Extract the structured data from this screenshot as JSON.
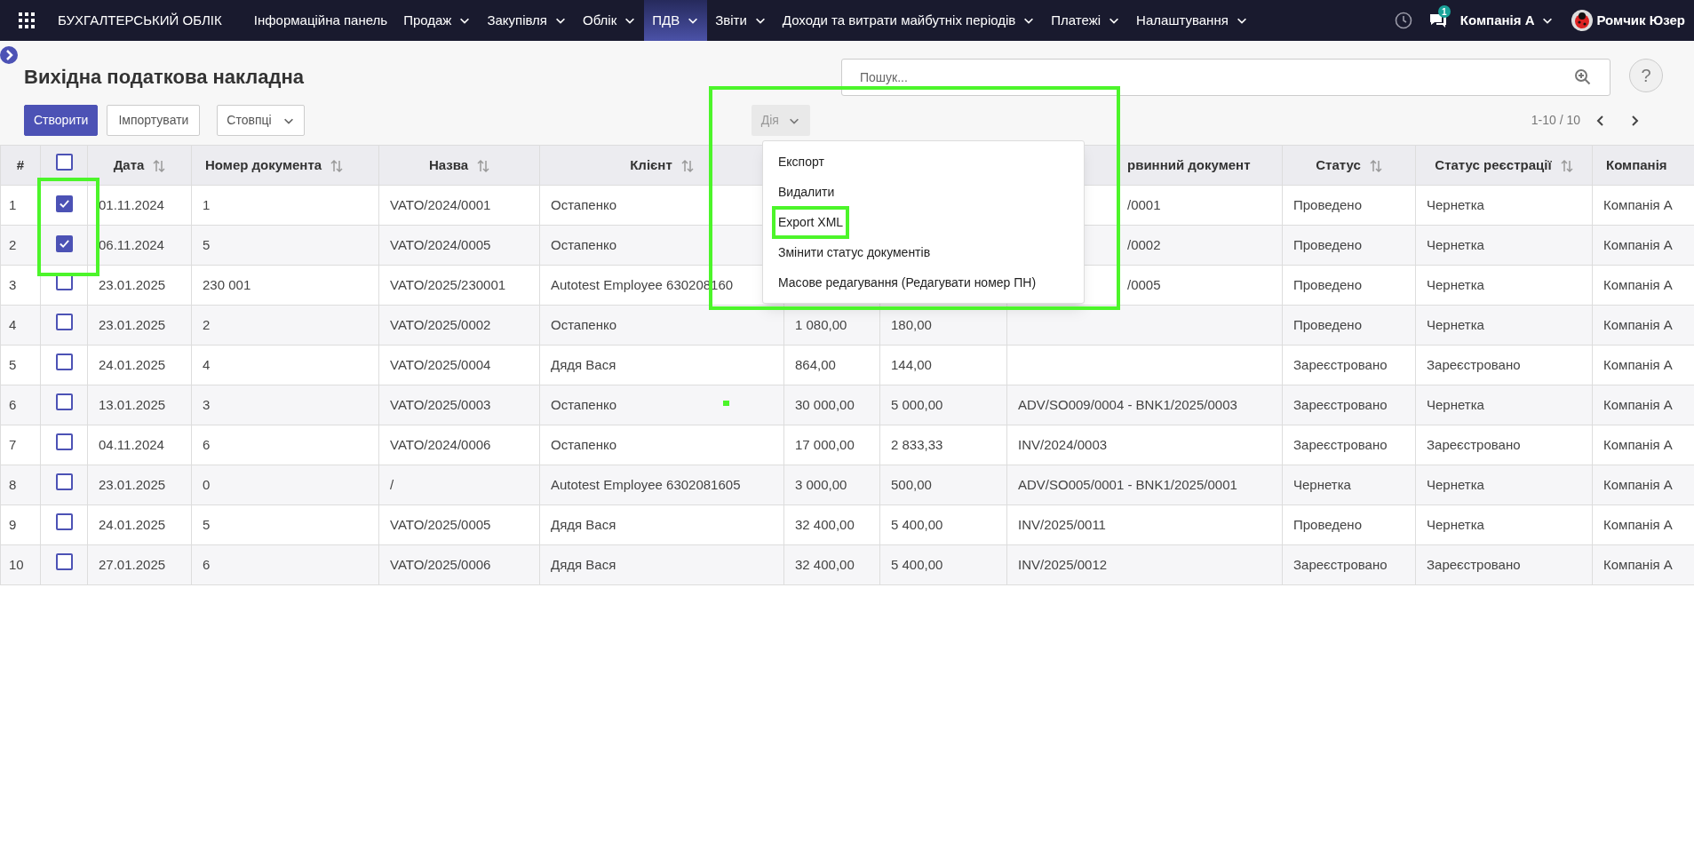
{
  "navbar": {
    "app_title": "БУХГАЛТЕРСЬКИЙ ОБЛІК",
    "items": [
      {
        "label": "Інформаційна панель",
        "dropdown": false,
        "selected": false
      },
      {
        "label": "Продаж",
        "dropdown": true,
        "selected": false
      },
      {
        "label": "Закупівля",
        "dropdown": true,
        "selected": false
      },
      {
        "label": "Облік",
        "dropdown": true,
        "selected": false
      },
      {
        "label": "ПДВ",
        "dropdown": true,
        "selected": true
      },
      {
        "label": "Звіти",
        "dropdown": true,
        "selected": false
      },
      {
        "label": "Доходи та витрати майбутніх періодів",
        "dropdown": true,
        "selected": false
      },
      {
        "label": "Платежі",
        "dropdown": true,
        "selected": false
      },
      {
        "label": "Налаштування",
        "dropdown": true,
        "selected": false
      }
    ],
    "messages_badge": "1",
    "company": "Компанія А",
    "user": "Ромчик Юзер"
  },
  "page": {
    "title": "Вихідна податкова накладна",
    "search": {
      "placeholder": "Пошук..."
    },
    "help": "?",
    "buttons": [
      {
        "label": "Створити",
        "kind": "primary"
      },
      {
        "label": "Імпортувати",
        "kind": "secondary"
      },
      {
        "label": "Стовпці",
        "kind": "dropdown"
      }
    ],
    "action_button": {
      "label": "Дія"
    },
    "pager": "1-10 / 10"
  },
  "action_menu": [
    {
      "label": "Експорт",
      "highlighted": false
    },
    {
      "label": "Видалити",
      "highlighted": false
    },
    {
      "label": "Export XML",
      "highlighted": true
    },
    {
      "label": "Змінити статус документів",
      "highlighted": false
    },
    {
      "label": "Масове редагування (Редагувати номер ПН)",
      "highlighted": false
    }
  ],
  "table": {
    "select_all": {
      "checked": false
    },
    "columns": [
      {
        "label": "#",
        "sortable": false
      },
      {
        "label": "Дата",
        "sortable": true
      },
      {
        "label": "Номер документа",
        "sortable": true
      },
      {
        "label": "Назва",
        "sortable": true
      },
      {
        "label": "Клієнт",
        "sortable": true
      },
      null,
      null,
      {
        "label": "рвинний документ",
        "sortable": false
      },
      {
        "label": "Статус",
        "sortable": true
      },
      {
        "label": "Статус реєстрації",
        "sortable": true
      },
      {
        "label": "Компанія",
        "sortable": false
      }
    ],
    "rows": [
      {
        "checked": true,
        "cells": [
          "1",
          "01.11.2024",
          "1",
          "VATO/2024/0001",
          "Остапенко",
          null,
          null,
          "/0001",
          "Проведено",
          "Чернетка",
          "Компанія А"
        ]
      },
      {
        "checked": true,
        "cells": [
          "2",
          "06.11.2024",
          "5",
          "VATO/2024/0005",
          "Остапенко",
          null,
          null,
          "/0002",
          "Проведено",
          "Чернетка",
          "Компанія А"
        ]
      },
      {
        "checked": false,
        "cells": [
          "3",
          "23.01.2025",
          "230 001",
          "VATO/2025/230001",
          "Autotest Employee 630208160",
          null,
          null,
          "/0005",
          "Проведено",
          "Чернетка",
          "Компанія А"
        ]
      },
      {
        "checked": false,
        "cells": [
          "4",
          "23.01.2025",
          "2",
          "VATO/2025/0002",
          "Остапенко",
          "1 080,00",
          "180,00",
          null,
          "Проведено",
          "Чернетка",
          "Компанія А"
        ]
      },
      {
        "checked": false,
        "cells": [
          "5",
          "24.01.2025",
          "4",
          "VATO/2025/0004",
          "Дядя Вася",
          "864,00",
          "144,00",
          null,
          "Зареєстровано",
          "Зареєстровано",
          "Компанія А"
        ]
      },
      {
        "checked": false,
        "cells": [
          "6",
          "13.01.2025",
          "3",
          "VATO/2025/0003",
          "Остапенко",
          "30 000,00",
          "5 000,00",
          "ADV/SO009/0004 - BNK1/2025/0003",
          "Зареєстровано",
          "Чернетка",
          "Компанія А"
        ]
      },
      {
        "checked": false,
        "cells": [
          "7",
          "04.11.2024",
          "6",
          "VATO/2024/0006",
          "Остапенко",
          "17 000,00",
          "2 833,33",
          "INV/2024/0003",
          "Зареєстровано",
          "Зареєстровано",
          "Компанія А"
        ]
      },
      {
        "checked": false,
        "cells": [
          "8",
          "23.01.2025",
          "0",
          "/",
          "Autotest Employee 6302081605",
          "3 000,00",
          "500,00",
          "ADV/SO005/0001 - BNK1/2025/0001",
          "Чернетка",
          "Чернетка",
          "Компанія А"
        ]
      },
      {
        "checked": false,
        "cells": [
          "9",
          "24.01.2025",
          "5",
          "VATO/2025/0005",
          "Дядя Вася",
          "32 400,00",
          "5 400,00",
          "INV/2025/0011",
          "Проведено",
          "Чернетка",
          "Компанія А"
        ]
      },
      {
        "checked": false,
        "cells": [
          "10",
          "27.01.2025",
          "6",
          "VATO/2025/0006",
          "Дядя Вася",
          "32 400,00",
          "5 400,00",
          "INV/2025/0012",
          "Зареєстровано",
          "Зареєстровано",
          "Компанія А"
        ]
      }
    ]
  }
}
